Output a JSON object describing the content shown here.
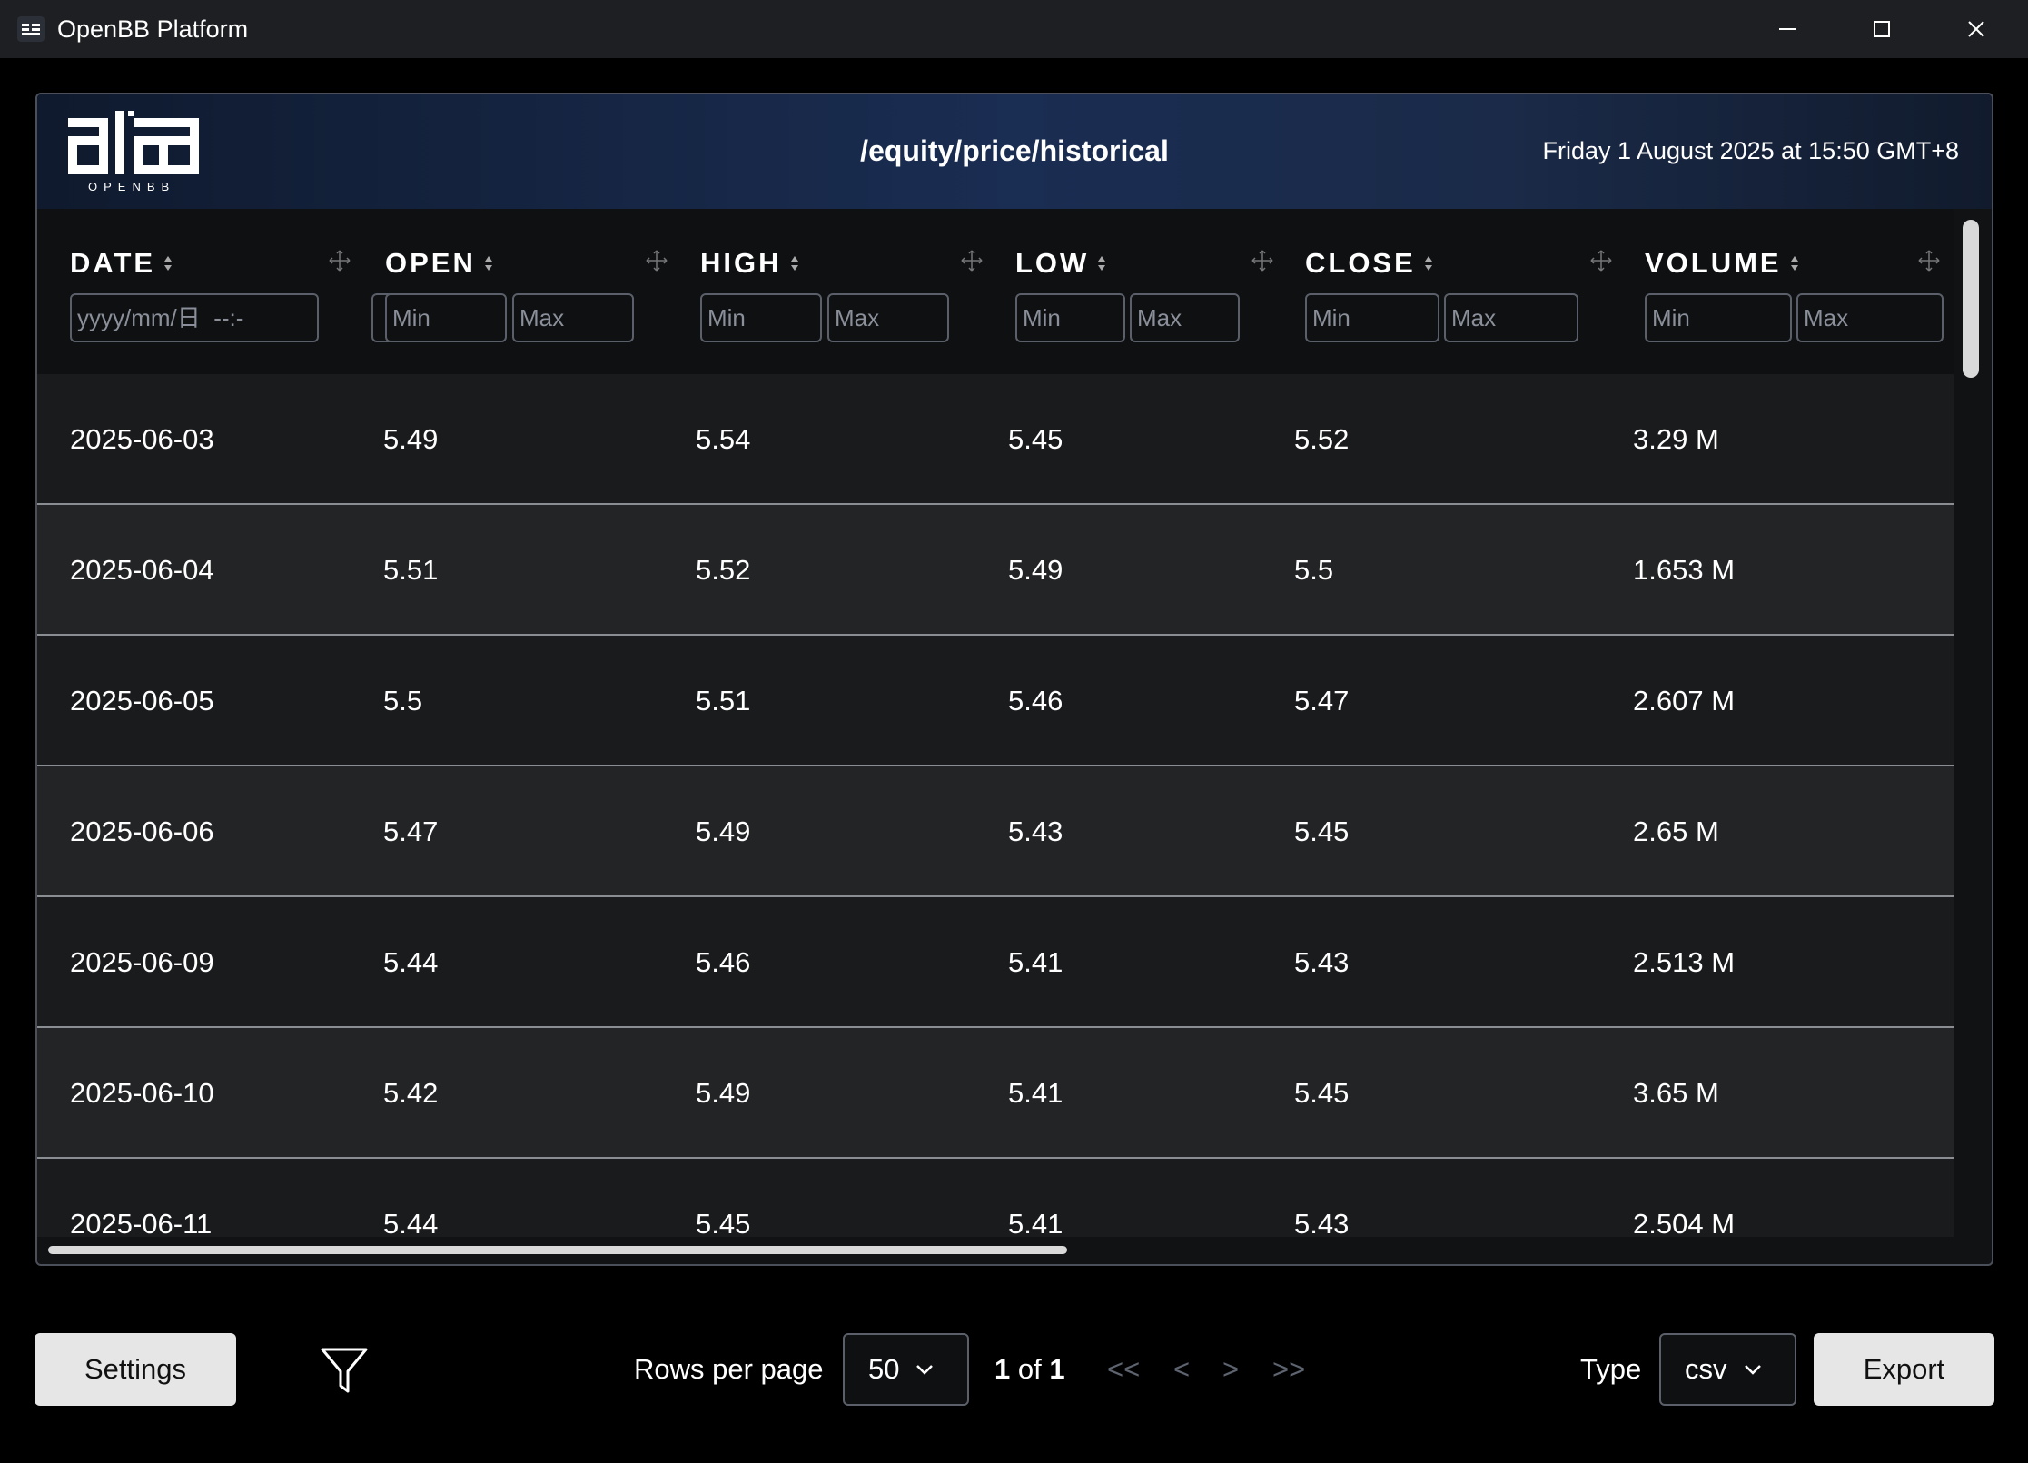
{
  "window": {
    "title": "OpenBB Platform"
  },
  "header": {
    "route": "/equity/price/historical",
    "timestamp": "Friday 1 August 2025 at 15:50 GMT+8",
    "logo_text": "OPENBB"
  },
  "columns": [
    {
      "key": "date",
      "label": "DATE",
      "placeholder": "yyyy/mm/日  --:-"
    },
    {
      "key": "open",
      "label": "OPEN",
      "min_placeholder": "Min",
      "max_placeholder": "Max"
    },
    {
      "key": "high",
      "label": "HIGH",
      "min_placeholder": "Min",
      "max_placeholder": "Max"
    },
    {
      "key": "low",
      "label": "LOW",
      "min_placeholder": "Min",
      "max_placeholder": "Max"
    },
    {
      "key": "close",
      "label": "CLOSE",
      "min_placeholder": "Min",
      "max_placeholder": "Max"
    },
    {
      "key": "volume",
      "label": "VOLUME",
      "min_placeholder": "Min",
      "max_placeholder": "Max"
    }
  ],
  "rows": [
    {
      "date": "2025-06-03",
      "open": "5.49",
      "high": "5.54",
      "low": "5.45",
      "close": "5.52",
      "volume": "3.29 M"
    },
    {
      "date": "2025-06-04",
      "open": "5.51",
      "high": "5.52",
      "low": "5.49",
      "close": "5.5",
      "volume": "1.653 M"
    },
    {
      "date": "2025-06-05",
      "open": "5.5",
      "high": "5.51",
      "low": "5.46",
      "close": "5.47",
      "volume": "2.607 M"
    },
    {
      "date": "2025-06-06",
      "open": "5.47",
      "high": "5.49",
      "low": "5.43",
      "close": "5.45",
      "volume": "2.65 M"
    },
    {
      "date": "2025-06-09",
      "open": "5.44",
      "high": "5.46",
      "low": "5.41",
      "close": "5.43",
      "volume": "2.513 M"
    },
    {
      "date": "2025-06-10",
      "open": "5.42",
      "high": "5.49",
      "low": "5.41",
      "close": "5.45",
      "volume": "3.65 M"
    },
    {
      "date": "2025-06-11",
      "open": "5.44",
      "high": "5.45",
      "low": "5.41",
      "close": "5.43",
      "volume": "2.504 M"
    }
  ],
  "footer": {
    "settings_label": "Settings",
    "rows_per_page_label": "Rows per page",
    "rows_per_page_value": "50",
    "page_current": "1",
    "page_of": "of",
    "page_total": "1",
    "nav_first": "<<",
    "nav_prev": "<",
    "nav_next": ">",
    "nav_last": ">>",
    "type_label": "Type",
    "type_value": "csv",
    "export_label": "Export"
  },
  "colors": {
    "accent_header": "#1a2d52",
    "row_odd": "#1a1b1d",
    "row_even": "#232426"
  }
}
